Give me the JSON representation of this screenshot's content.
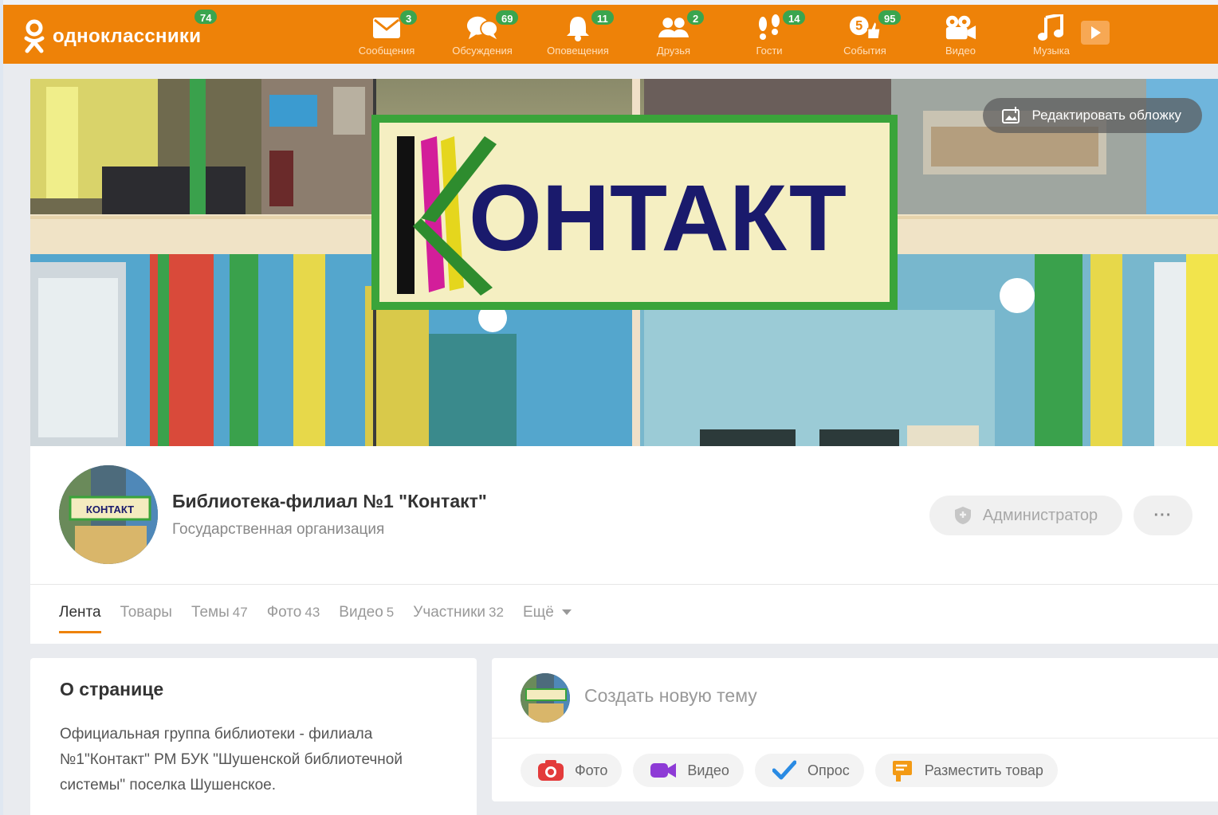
{
  "topbar": {
    "logo_text": "одноклассники",
    "logo_badge": "74",
    "nav": [
      {
        "label": "Сообщения",
        "badge": "3",
        "icon": "envelope-icon"
      },
      {
        "label": "Обсуждения",
        "badge": "69",
        "icon": "chat-bubbles-icon"
      },
      {
        "label": "Оповещения",
        "badge": "11",
        "icon": "bell-icon"
      },
      {
        "label": "Друзья",
        "badge": "2",
        "icon": "friends-icon"
      },
      {
        "label": "Гости",
        "badge": "14",
        "icon": "footprints-icon"
      },
      {
        "label": "События",
        "badge": "95",
        "icon": "events-like-icon"
      },
      {
        "label": "Видео",
        "badge": "",
        "icon": "video-camera-icon"
      },
      {
        "label": "Музыка",
        "badge": "",
        "icon": "music-note-icon"
      }
    ],
    "colors": {
      "bar": "#ee8208",
      "badge": "#3aa54e"
    }
  },
  "cover": {
    "sign_text": "ОНТАКТ",
    "edit_label": "Редактировать обложку"
  },
  "profile": {
    "name": "Библиотека-филиал №1 \"Контакт\"",
    "type": "Государственная организация",
    "admin_label": "Администратор",
    "more_label": "···",
    "avatar_sign": "КОНТАКТ",
    "tabs": [
      {
        "label": "Лента",
        "count": ""
      },
      {
        "label": "Товары",
        "count": ""
      },
      {
        "label": "Темы",
        "count": "47"
      },
      {
        "label": "Фото",
        "count": "43"
      },
      {
        "label": "Видео",
        "count": "5"
      },
      {
        "label": "Участники",
        "count": "32"
      },
      {
        "label": "Ещё",
        "count": ""
      }
    ]
  },
  "about": {
    "title": "О странице",
    "text": "Официальная группа библиотеки - филиала №1\"Контакт\" РМ БУК \"Шушенской библиотечной системы\" поселка Шушенское."
  },
  "composer": {
    "placeholder": "Создать новую тему",
    "actions": [
      {
        "label": "Фото",
        "icon": "camera-icon"
      },
      {
        "label": "Видео",
        "icon": "video-icon"
      },
      {
        "label": "Опрос",
        "icon": "checkmark-icon"
      },
      {
        "label": "Разместить товар",
        "icon": "price-tag-icon"
      }
    ]
  }
}
